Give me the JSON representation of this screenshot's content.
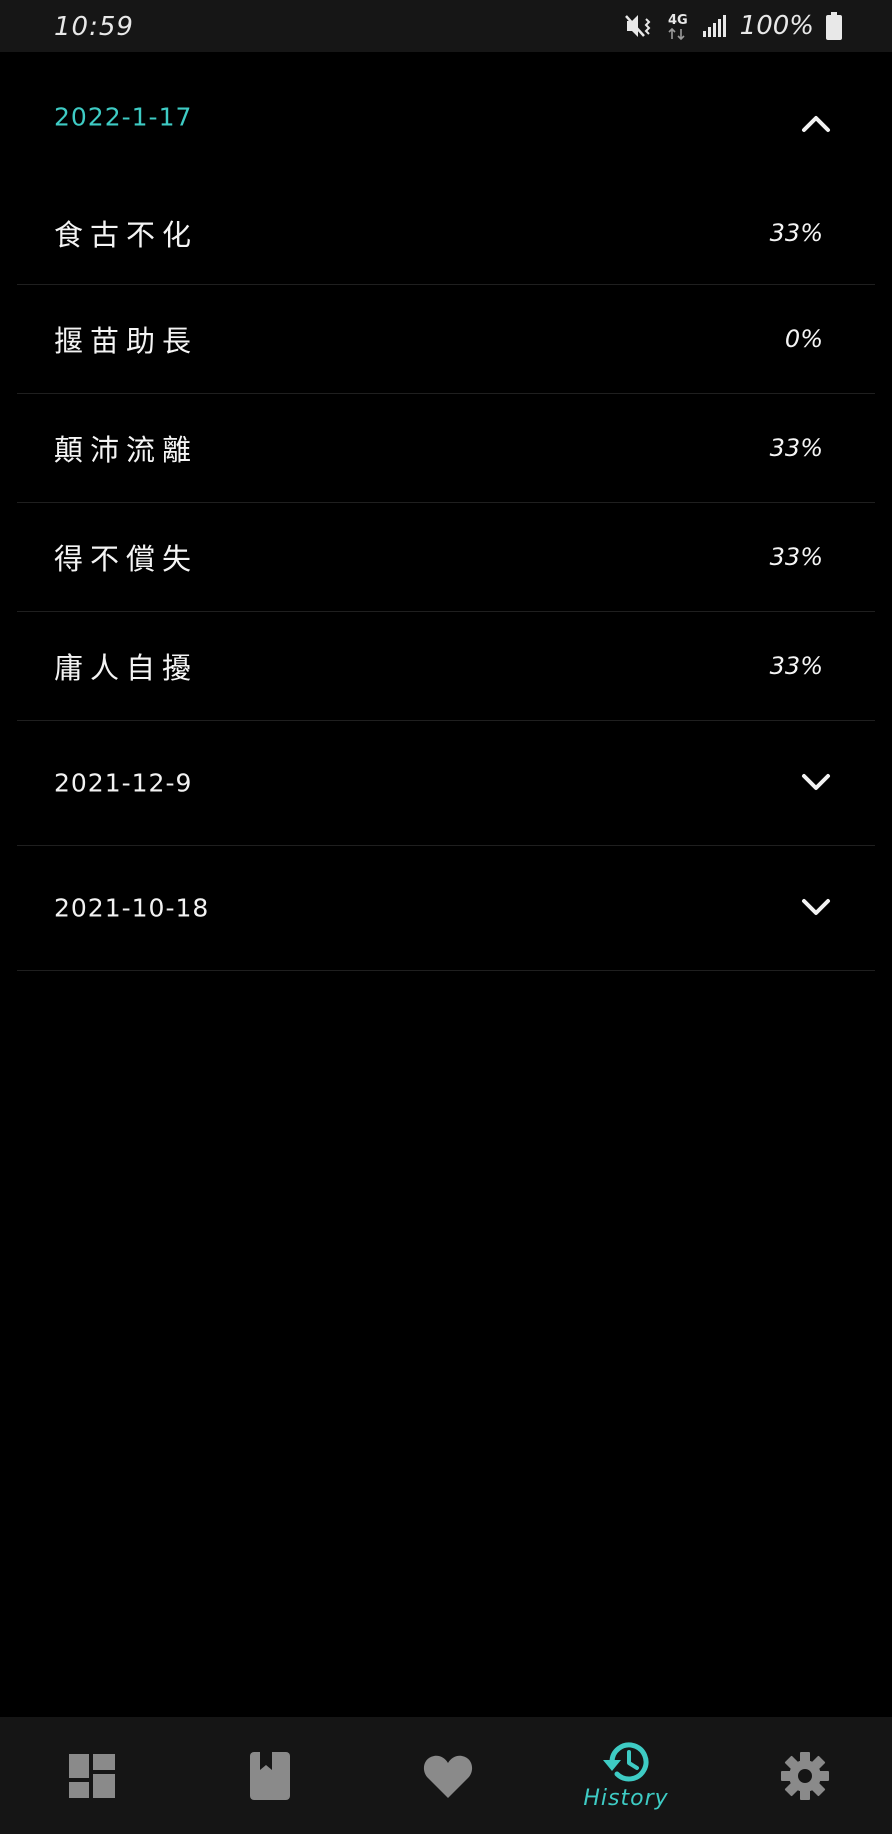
{
  "status_bar": {
    "time": "10:59",
    "network": "4G",
    "battery": "100%",
    "icons": [
      "mute-vibrate-icon",
      "network-4g-icon",
      "signal-bars-icon",
      "battery-full-icon"
    ]
  },
  "groups": [
    {
      "date": "2022-1-17",
      "state": "expanded",
      "entries": [
        {
          "word": "食古不化",
          "score": "33%"
        },
        {
          "word": "揠苗助長",
          "score": "0%"
        },
        {
          "word": "顛沛流離",
          "score": "33%"
        },
        {
          "word": "得不償失",
          "score": "33%"
        },
        {
          "word": "庸人自擾",
          "score": "33%"
        }
      ]
    },
    {
      "date": "2021-12-9",
      "state": "collapsed"
    },
    {
      "date": "2021-10-18",
      "state": "collapsed"
    }
  ],
  "bottom_nav": {
    "items": [
      {
        "icon": "dashboard-icon",
        "label": ""
      },
      {
        "icon": "book-icon",
        "label": ""
      },
      {
        "icon": "heart-icon",
        "label": ""
      },
      {
        "icon": "history-icon",
        "label": "History",
        "active": true
      },
      {
        "icon": "settings-gear-icon",
        "label": ""
      }
    ]
  },
  "colors": {
    "accent": "#3ecbc4",
    "background": "#000000",
    "nav_background": "#151515",
    "divider": "#1f1f1f",
    "inactive_icon": "#8a8a8a"
  }
}
